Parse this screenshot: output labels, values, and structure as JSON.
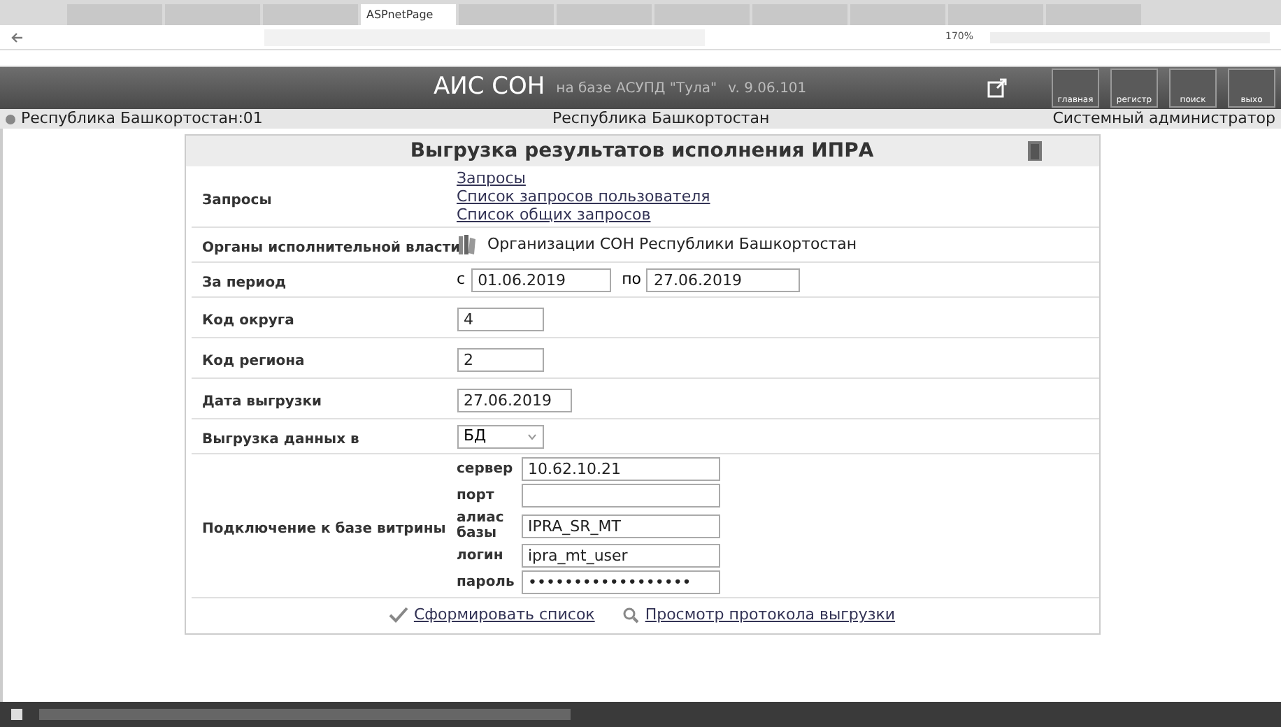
{
  "browser": {
    "tabs": [
      {
        "selected": false
      },
      {
        "selected": false
      },
      {
        "selected": false
      },
      {
        "selected": true,
        "label": "ASPnetPage"
      },
      {
        "selected": false
      },
      {
        "selected": false
      },
      {
        "selected": false
      },
      {
        "selected": false
      },
      {
        "selected": false
      },
      {
        "selected": false
      },
      {
        "selected": false
      }
    ],
    "zoom": "170%"
  },
  "header": {
    "title": "АИС СОН",
    "subtitle": "на базе АСУПД \"Тула\"",
    "version": "v. 9.06.101",
    "nav_buttons": [
      "главная",
      "регистр",
      "поиск",
      "выхо"
    ]
  },
  "info_bar": {
    "region": "Республика Башкортостан:01",
    "center": "Республика Башкортостан",
    "user": "Системный администратор"
  },
  "form": {
    "title": "Выгрузка результатов исполнения ИПРА",
    "rows": [
      {
        "kind": "links",
        "label": "Запросы",
        "links": [
          "Запросы",
          "Список запросов пользователя",
          "Список общих запросов"
        ]
      },
      {
        "kind": "org",
        "label": "Органы исполнительной власти",
        "value": "Организации СОН Республики Башкортостан"
      },
      {
        "kind": "period",
        "label": "За период",
        "from_label": "с",
        "from": "01.06.2019",
        "to_label": "по",
        "to": "27.06.2019"
      },
      {
        "kind": "input",
        "label": "Код округа",
        "value": "4"
      },
      {
        "kind": "input",
        "label": "Код региона",
        "value": "2"
      },
      {
        "kind": "date",
        "label": "Дата выгрузки",
        "value": "27.06.2019"
      },
      {
        "kind": "select",
        "label": "Выгрузка данных в",
        "value": "БД"
      },
      {
        "kind": "connection",
        "label": "Подключение к базе витрины",
        "fields": [
          {
            "label": "сервер",
            "value": "10.62.10.21"
          },
          {
            "label": "порт"
          },
          {
            "label": "алиас базы",
            "value": "IPRA_SR_MT"
          },
          {
            "label": "логин",
            "value": "ipra_mt_user"
          },
          {
            "label": "пароль",
            "value": "••••••••••••••••••"
          }
        ]
      }
    ],
    "actions": [
      {
        "kind": "check",
        "label": "Сформировать список"
      },
      {
        "kind": "view",
        "label": "Просмотр протокола выгрузки"
      }
    ]
  }
}
